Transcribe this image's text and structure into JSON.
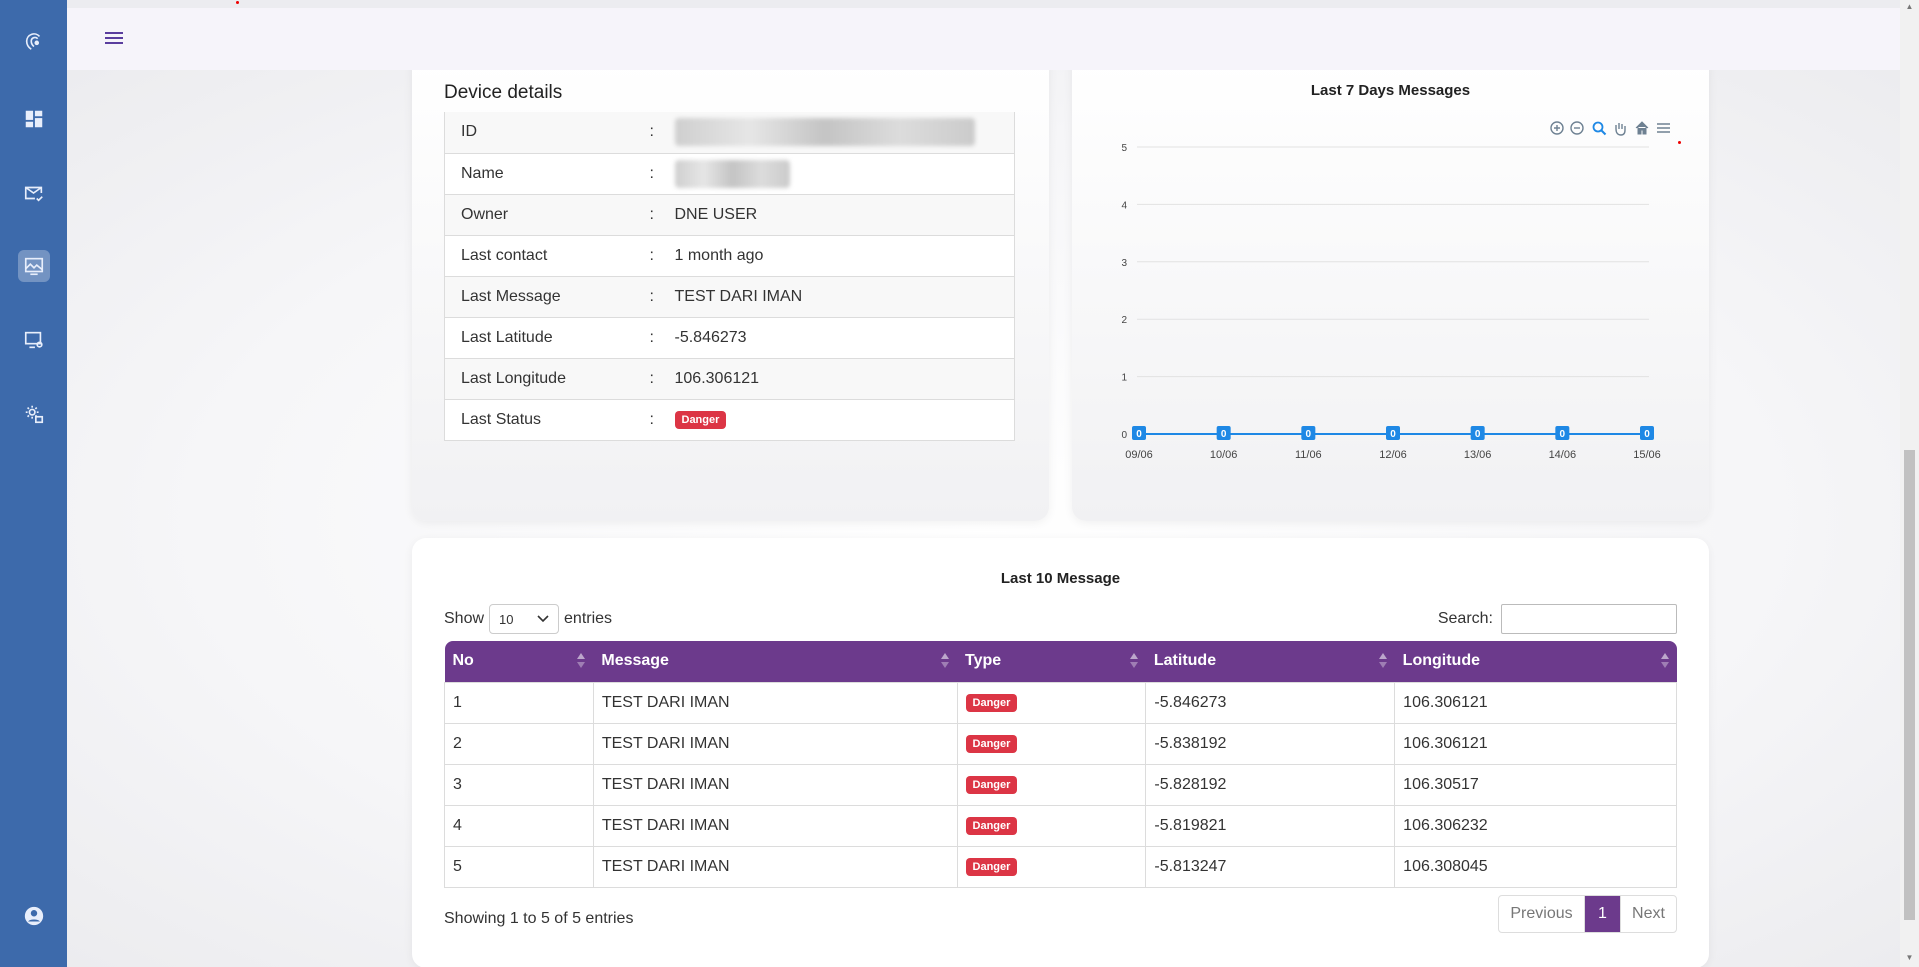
{
  "header": {
    "menu_icon": "hamburger-icon"
  },
  "sidebar": {
    "items": [
      {
        "icon": "logo-signal-icon"
      },
      {
        "icon": "dashboard-icon"
      },
      {
        "icon": "mail-check-icon"
      },
      {
        "icon": "monitor-chart-icon",
        "active": true
      },
      {
        "icon": "device-settings-icon"
      },
      {
        "icon": "gear-user-icon"
      },
      {
        "icon": "user-icon"
      }
    ]
  },
  "device_details": {
    "title": "Device details",
    "rows": [
      {
        "label": "ID",
        "sep": ":",
        "value": ""
      },
      {
        "label": "Name",
        "sep": ":",
        "value": ""
      },
      {
        "label": "Owner",
        "sep": ":",
        "value": "DNE USER"
      },
      {
        "label": "Last contact",
        "sep": ":",
        "value": "1 month ago"
      },
      {
        "label": "Last Message",
        "sep": ":",
        "value": "TEST DARI IMAN"
      },
      {
        "label": "Last Latitude",
        "sep": ":",
        "value": "-5.846273"
      },
      {
        "label": "Last Longitude",
        "sep": ":",
        "value": "106.306121"
      },
      {
        "label": "Last Status",
        "sep": ":",
        "value": "Danger"
      }
    ]
  },
  "chart_data": {
    "type": "line",
    "title": "Last 7 Days Messages",
    "categories": [
      "09/06",
      "10/06",
      "11/06",
      "12/06",
      "13/06",
      "14/06",
      "15/06"
    ],
    "series": [
      {
        "values": [
          0,
          0,
          0,
          0,
          0,
          0,
          0
        ]
      }
    ],
    "ylim": [
      0,
      5
    ],
    "yticks": [
      "0",
      "1",
      "2",
      "3",
      "4",
      "5"
    ],
    "grid": true,
    "data_labels": true,
    "line_color": "#1e88e5",
    "toolbar": [
      "zoom-in-icon",
      "zoom-out-icon",
      "search-zoom-icon",
      "pan-hand-icon",
      "home-icon",
      "menu-icon"
    ]
  },
  "messages": {
    "title": "Last 10 Message",
    "show_label": "Show",
    "page_size": "10",
    "entries_label": "entries",
    "search_label": "Search:",
    "search_value": "",
    "columns": [
      "No",
      "Message",
      "Type",
      "Latitude",
      "Longitude"
    ],
    "rows": [
      {
        "no": "1",
        "message": "TEST DARI IMAN",
        "type": "Danger",
        "lat": "-5.846273",
        "lon": "106.306121"
      },
      {
        "no": "2",
        "message": "TEST DARI IMAN",
        "type": "Danger",
        "lat": "-5.838192",
        "lon": "106.306121"
      },
      {
        "no": "3",
        "message": "TEST DARI IMAN",
        "type": "Danger",
        "lat": "-5.828192",
        "lon": "106.30517"
      },
      {
        "no": "4",
        "message": "TEST DARI IMAN",
        "type": "Danger",
        "lat": "-5.819821",
        "lon": "106.306232"
      },
      {
        "no": "5",
        "message": "TEST DARI IMAN",
        "type": "Danger",
        "lat": "-5.813247",
        "lon": "106.308045"
      }
    ],
    "showing": "Showing 1 to 5 of 5 entries",
    "pagination": {
      "previous": "Previous",
      "current": "1",
      "next": "Next"
    }
  },
  "colors": {
    "sidebar": "#3d6aab",
    "accent": "#6c3a8c",
    "danger": "#dc3545"
  }
}
